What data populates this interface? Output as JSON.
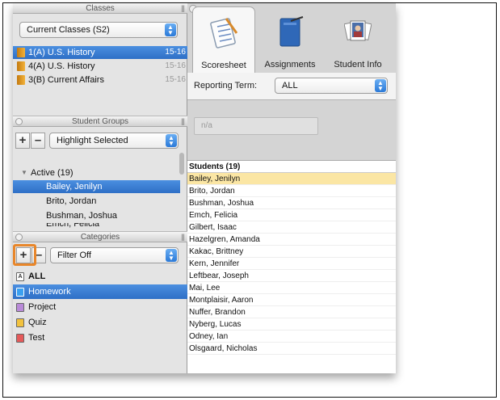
{
  "classes_panel": {
    "title": "Classes",
    "current_selector": "Current Classes (S2)",
    "items": [
      {
        "name": "1(A) U.S. History",
        "year": "15-16"
      },
      {
        "name": "4(A) U.S. History",
        "year": "15-16"
      },
      {
        "name": "3(B) Current Affairs",
        "year": "15-16"
      }
    ]
  },
  "student_groups_panel": {
    "title": "Student Groups",
    "highlight_selector": "Highlight Selected",
    "group_label": "Active (19)",
    "members": [
      "Bailey, Jenilyn",
      "Brito, Jordan",
      "Bushman, Joshua",
      "Emch, Felicia"
    ]
  },
  "categories_panel": {
    "title": "Categories",
    "filter_selector": "Filter Off",
    "items": [
      {
        "name": "ALL",
        "icon": "all-icon",
        "icon_letter": "A",
        "color": "#ffffff"
      },
      {
        "name": "Homework",
        "icon": "homework-icon",
        "icon_letter": "",
        "color": "#3aa0f0"
      },
      {
        "name": "Project",
        "icon": "project-icon",
        "icon_letter": "",
        "color": "#b98ad8"
      },
      {
        "name": "Quiz",
        "icon": "quiz-icon",
        "icon_letter": "",
        "color": "#f2c23e"
      },
      {
        "name": "Test",
        "icon": "test-icon",
        "icon_letter": "",
        "color": "#e55a5a"
      }
    ]
  },
  "tabs": [
    {
      "label": "Scoresheet"
    },
    {
      "label": "Assignments"
    },
    {
      "label": "Student Info"
    }
  ],
  "reporting_term": {
    "label": "Reporting Term:",
    "value": "ALL"
  },
  "na_field": "n/a",
  "students": {
    "header": "Students (19)",
    "names": [
      "Bailey, Jenilyn",
      "Brito, Jordan",
      "Bushman, Joshua",
      "Emch, Felicia",
      "Gilbert, Isaac",
      "Hazelgren, Amanda",
      "Kakac, Brittney",
      "Kern, Jennifer",
      "Leftbear, Joseph",
      "Mai, Lee",
      "Montplaisir, Aaron",
      "Nuffer, Brandon",
      "Nyberg, Lucas",
      "Odney, Ian",
      "Olsgaard, Nicholas"
    ]
  },
  "buttons": {
    "plus": "+",
    "minus": "–"
  },
  "colors": {
    "selection_blue": "#2e6fc6",
    "highlight_orange": "#e8862a",
    "student_selected": "#fbe6a4"
  }
}
